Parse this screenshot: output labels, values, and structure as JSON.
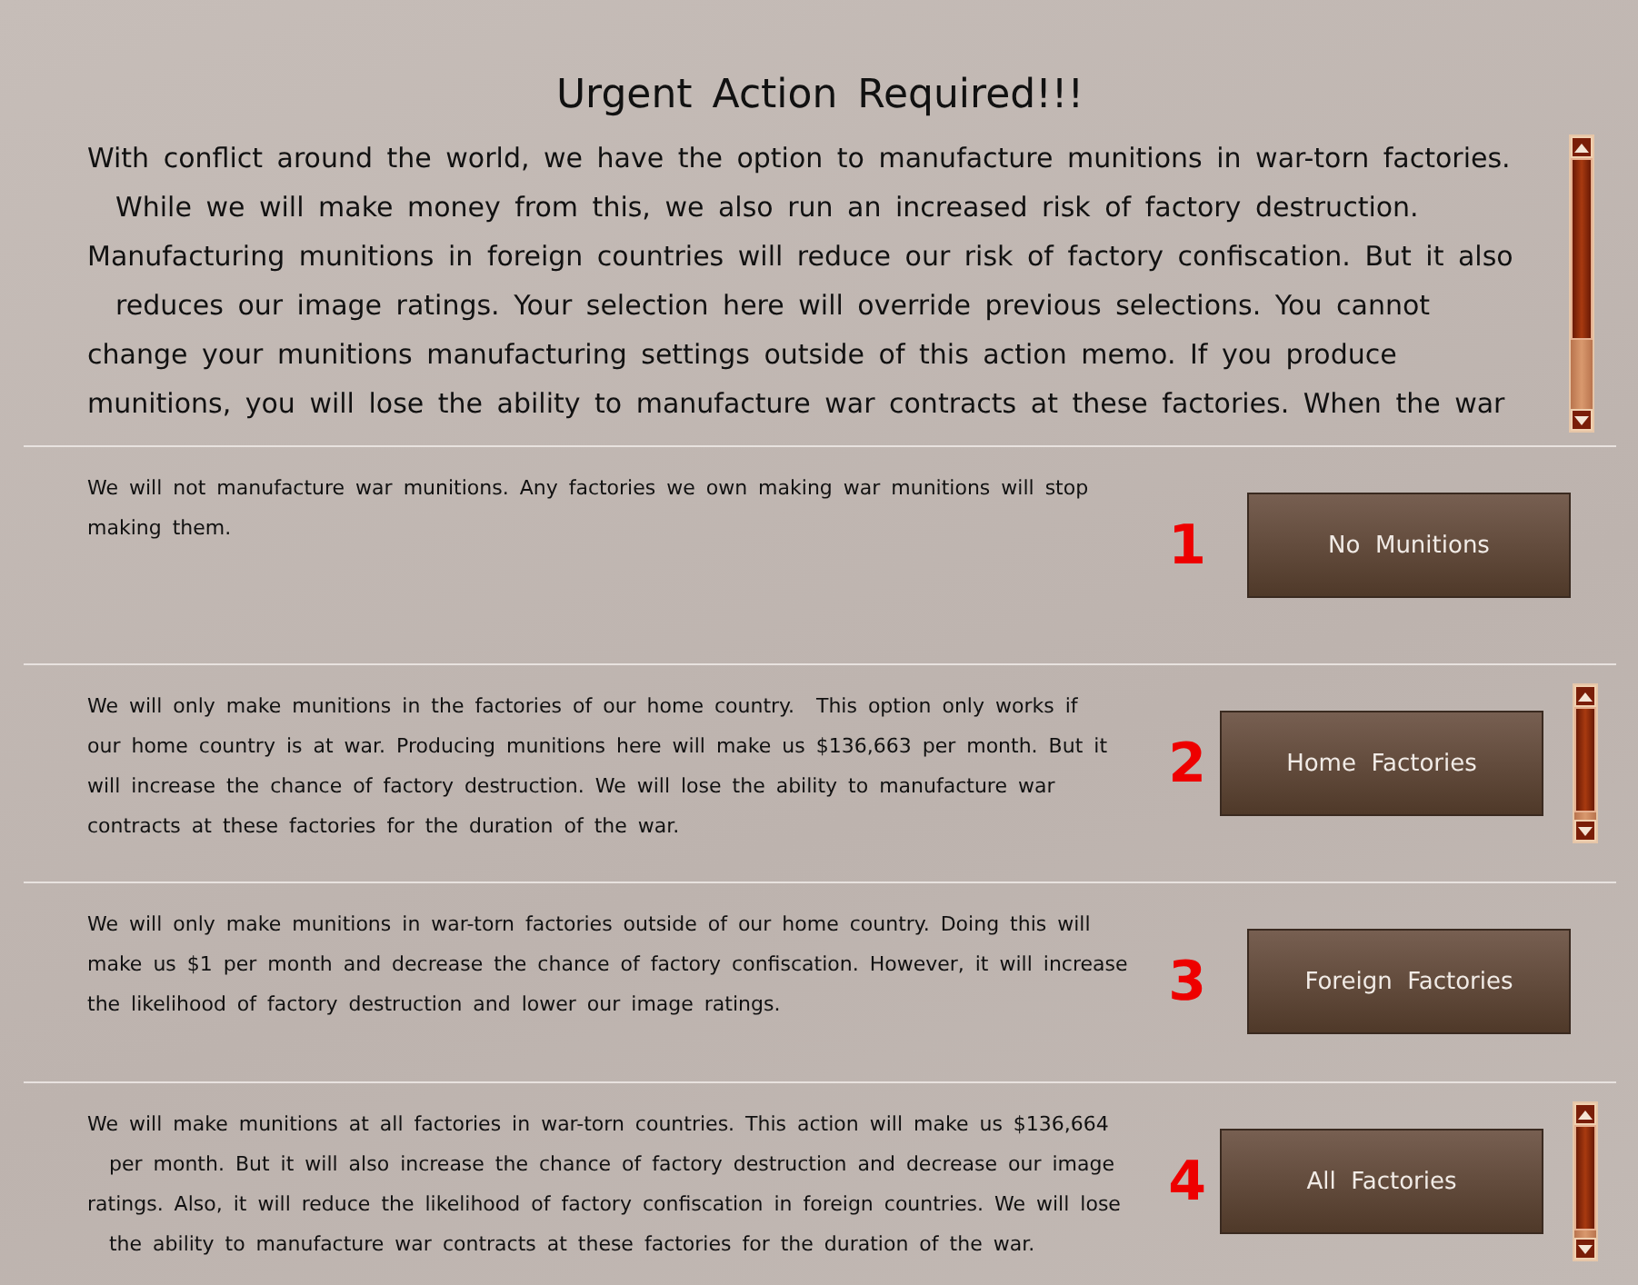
{
  "title": "Urgent Action Required!!!",
  "intro": {
    "lines": [
      "With conflict around the world, we have the option to manufacture munitions in war-torn factories.",
      "  While we will make money from this, we also run an increased risk of factory destruction.",
      "Manufacturing munitions in foreign countries will reduce our risk of factory confiscation. But it also",
      "  reduces our image ratings. Your selection here will override previous selections. You cannot",
      "change your munitions manufacturing settings outside of this action memo. If you produce",
      "munitions, you will lose the ability to manufacture war contracts at these factories. When the war"
    ],
    "scrollable": true
  },
  "options": [
    {
      "number": "1",
      "lines": [
        "We will not manufacture war munitions. Any factories we own making war munitions will stop",
        "making them."
      ],
      "button": "No  Munitions"
    },
    {
      "number": "2",
      "lines": [
        "We will only make munitions in the factories of our home country.  This option only works if",
        "our home country is at war. Producing munitions here will make us $136,663 per month. But it",
        "will increase the chance of factory destruction. We will lose the ability to manufacture war",
        "contracts at these factories for the duration of the war."
      ],
      "button": "Home  Factories",
      "scrollable": true
    },
    {
      "number": "3",
      "lines": [
        "We will only make munitions in war-torn factories outside of our home country. Doing this will",
        "make us $1 per month and decrease the chance of factory confiscation. However, it will increase",
        "the likelihood of factory destruction and lower our image ratings."
      ],
      "button": "Foreign  Factories"
    },
    {
      "number": "4",
      "lines": [
        "We will make munitions at all factories in war-torn countries. This action will make us $136,664",
        "  per month. But it will also increase the chance of factory destruction and decrease our image",
        "ratings. Also, it will reduce the likelihood of factory confiscation in foreign countries. We will lose",
        "  the ability to manufacture war contracts at these factories for the duration of the war."
      ],
      "button": "All  Factories",
      "scrollable": true
    }
  ]
}
